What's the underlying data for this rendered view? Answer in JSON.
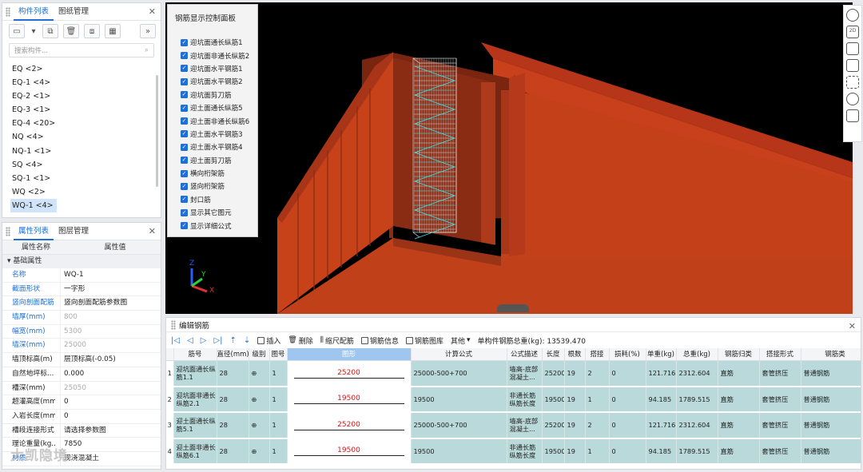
{
  "left_top": {
    "tabs": [
      "构件列表",
      "图纸管理"
    ],
    "search_placeholder": "搜索构件...",
    "components": [
      "EQ <2>",
      "EQ-1 <4>",
      "EQ-2 <1>",
      "EQ-3 <1>",
      "EQ-4 <20>",
      "NQ <4>",
      "NQ-1 <1>",
      "SQ <4>",
      "SQ-1 <1>",
      "WQ <2>",
      "WQ-1 <4>"
    ],
    "selected_index": 10
  },
  "left_bottom": {
    "tabs": [
      "属性列表",
      "图层管理"
    ],
    "col_name": "属性名称",
    "col_value": "属性值",
    "group": "基础属性",
    "rows": [
      {
        "idx": "1",
        "k": "名称",
        "v": "WQ-1",
        "blue": true,
        "gray": false
      },
      {
        "idx": "2",
        "k": "截面形状",
        "v": "一字形",
        "blue": true,
        "gray": false
      },
      {
        "idx": "3",
        "k": "竖向剖面配筋",
        "v": "竖向剖面配筋参数图",
        "blue": true,
        "gray": false
      },
      {
        "idx": "4",
        "k": "墙厚(mm)",
        "v": "800",
        "blue": true,
        "gray": true
      },
      {
        "idx": "5",
        "k": "幅宽(mm)",
        "v": "5300",
        "blue": true,
        "gray": true
      },
      {
        "idx": "6",
        "k": "墙深(mm)",
        "v": "25000",
        "blue": true,
        "gray": true
      },
      {
        "idx": "7",
        "k": "墙顶标高(m)",
        "v": "层顶标高(-0.05)",
        "blue": false,
        "gray": false
      },
      {
        "idx": "8",
        "k": "自然地坪标...",
        "v": "0.000",
        "blue": false,
        "gray": false
      },
      {
        "idx": "9",
        "k": "槽深(mm)",
        "v": "25050",
        "blue": false,
        "gray": true
      },
      {
        "idx": "10",
        "k": "超灌高度(mm)",
        "v": "0",
        "blue": false,
        "gray": false
      },
      {
        "idx": "11",
        "k": "入岩长度(mm)",
        "v": "0",
        "blue": false,
        "gray": false
      },
      {
        "idx": "12",
        "k": "槽段连接形式",
        "v": "请选择参数图",
        "blue": false,
        "gray": false
      },
      {
        "idx": "13",
        "k": "理论重量(kg...",
        "v": "7850",
        "blue": false,
        "gray": false
      },
      {
        "idx": "14",
        "k": "材质",
        "v": "现浇混凝土",
        "blue": true,
        "gray": false
      }
    ],
    "watermark": "大凯隐境"
  },
  "control_panel": {
    "title": "钢筋显示控制面板",
    "items": [
      "迎坑面通长纵筋1",
      "迎坑面非通长纵筋2",
      "迎坑面水平钢筋1",
      "迎坑面水平钢筋2",
      "迎坑面剪刀筋",
      "迎土面通长纵筋5",
      "迎土面非通长纵筋6",
      "迎土面水平钢筋3",
      "迎土面水平钢筋4",
      "迎土面剪刀筋",
      "横向桁架筋",
      "竖向桁架筋",
      "封口筋",
      "显示其它图元",
      "显示详细公式"
    ]
  },
  "axes": {
    "x": "X",
    "y": "Y",
    "z": "Z"
  },
  "edit_panel": {
    "title": "编辑钢筋",
    "toolbar": {
      "insert": "插入",
      "delete": "删除",
      "scale": "缩尺配筋",
      "info": "钢筋信息",
      "library": "钢筋图库",
      "other": "其他",
      "total_weight": "单构件钢筋总重(kg): 13539.470"
    },
    "headers": [
      "筋号",
      "直径(mm)",
      "级别",
      "图号",
      "图形",
      "计算公式",
      "公式描述",
      "长度",
      "根数",
      "搭接",
      "损耗(%)",
      "单重(kg)",
      "总重(kg)",
      "钢筋归类",
      "搭接形式",
      "钢筋类"
    ],
    "rows": [
      {
        "idx": "1",
        "name": "迎坑面通长纵筋1.1",
        "dia": "28",
        "grade": "⊕",
        "fig": "1",
        "shape": "25200",
        "formula": "25000-500+700",
        "desc": "墙高-底部混凝土...",
        "len": "25200",
        "count": "19",
        "lap": "2",
        "loss": "0",
        "unit_w": "121.716",
        "total_w": "2312.604",
        "cat": "直筋",
        "lap_type": "套管挤压",
        "type": "普通钢筋"
      },
      {
        "idx": "2",
        "name": "迎坑面非通长纵筋2.1",
        "dia": "28",
        "grade": "⊕",
        "fig": "1",
        "shape": "19500",
        "formula": "19500",
        "desc": "非通长筋纵筋长度",
        "len": "19500",
        "count": "19",
        "lap": "1",
        "loss": "0",
        "unit_w": "94.185",
        "total_w": "1789.515",
        "cat": "直筋",
        "lap_type": "套管挤压",
        "type": "普通钢筋"
      },
      {
        "idx": "3",
        "name": "迎土面通长纵筋5.1",
        "dia": "28",
        "grade": "⊕",
        "fig": "1",
        "shape": "25200",
        "formula": "25000-500+700",
        "desc": "墙高-底部混凝土...",
        "len": "25200",
        "count": "19",
        "lap": "2",
        "loss": "0",
        "unit_w": "121.716",
        "total_w": "2312.604",
        "cat": "直筋",
        "lap_type": "套管挤压",
        "type": "普通钢筋"
      },
      {
        "idx": "4",
        "name": "迎土面非通长纵筋6.1",
        "dia": "28",
        "grade": "⊕",
        "fig": "1",
        "shape": "19500",
        "formula": "19500",
        "desc": "非通长筋纵筋长度",
        "len": "19500",
        "count": "19",
        "lap": "1",
        "loss": "0",
        "unit_w": "94.185",
        "total_w": "1789.515",
        "cat": "直筋",
        "lap_type": "套管挤压",
        "type": "普通钢筋"
      }
    ]
  },
  "colors": {
    "accent": "#1f6fd6",
    "wall": "#c8411c",
    "row_bg": "#b9d9da",
    "shape_value": "#d11111"
  }
}
